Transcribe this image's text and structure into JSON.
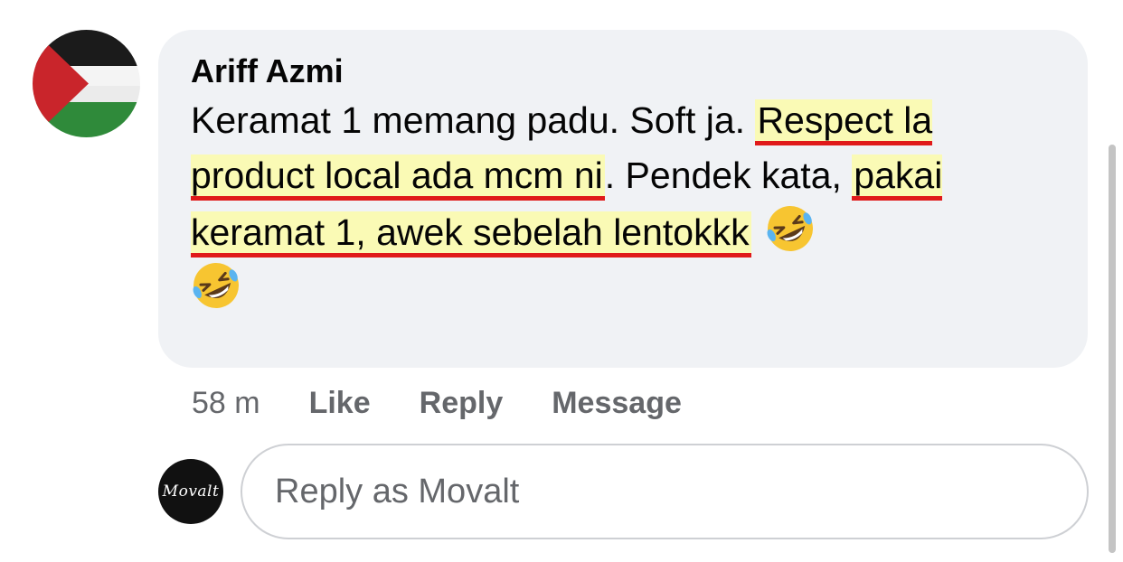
{
  "comment": {
    "author": "Ariff Azmi",
    "segments": [
      {
        "text": "Keramat 1 memang padu. Soft ja. ",
        "highlighted": false
      },
      {
        "text": "Respect la product local ada mcm ni",
        "highlighted": true
      },
      {
        "text": ". Pendek kata, ",
        "highlighted": false
      },
      {
        "text": "pakai keramat 1, awek sebelah lentokkk",
        "highlighted": true
      }
    ],
    "emojis": [
      "rolling-on-floor-laughing",
      "rolling-on-floor-laughing"
    ]
  },
  "actions": {
    "time": "58 m",
    "like": "Like",
    "reply": "Reply",
    "message": "Message"
  },
  "reply_box": {
    "placeholder": "Reply as Movalt",
    "avatar_text": "Movalt"
  },
  "colors": {
    "bubble": "#f0f2f5",
    "highlight": "#fafab5",
    "underline": "#e01a1a",
    "muted": "#65676b"
  }
}
